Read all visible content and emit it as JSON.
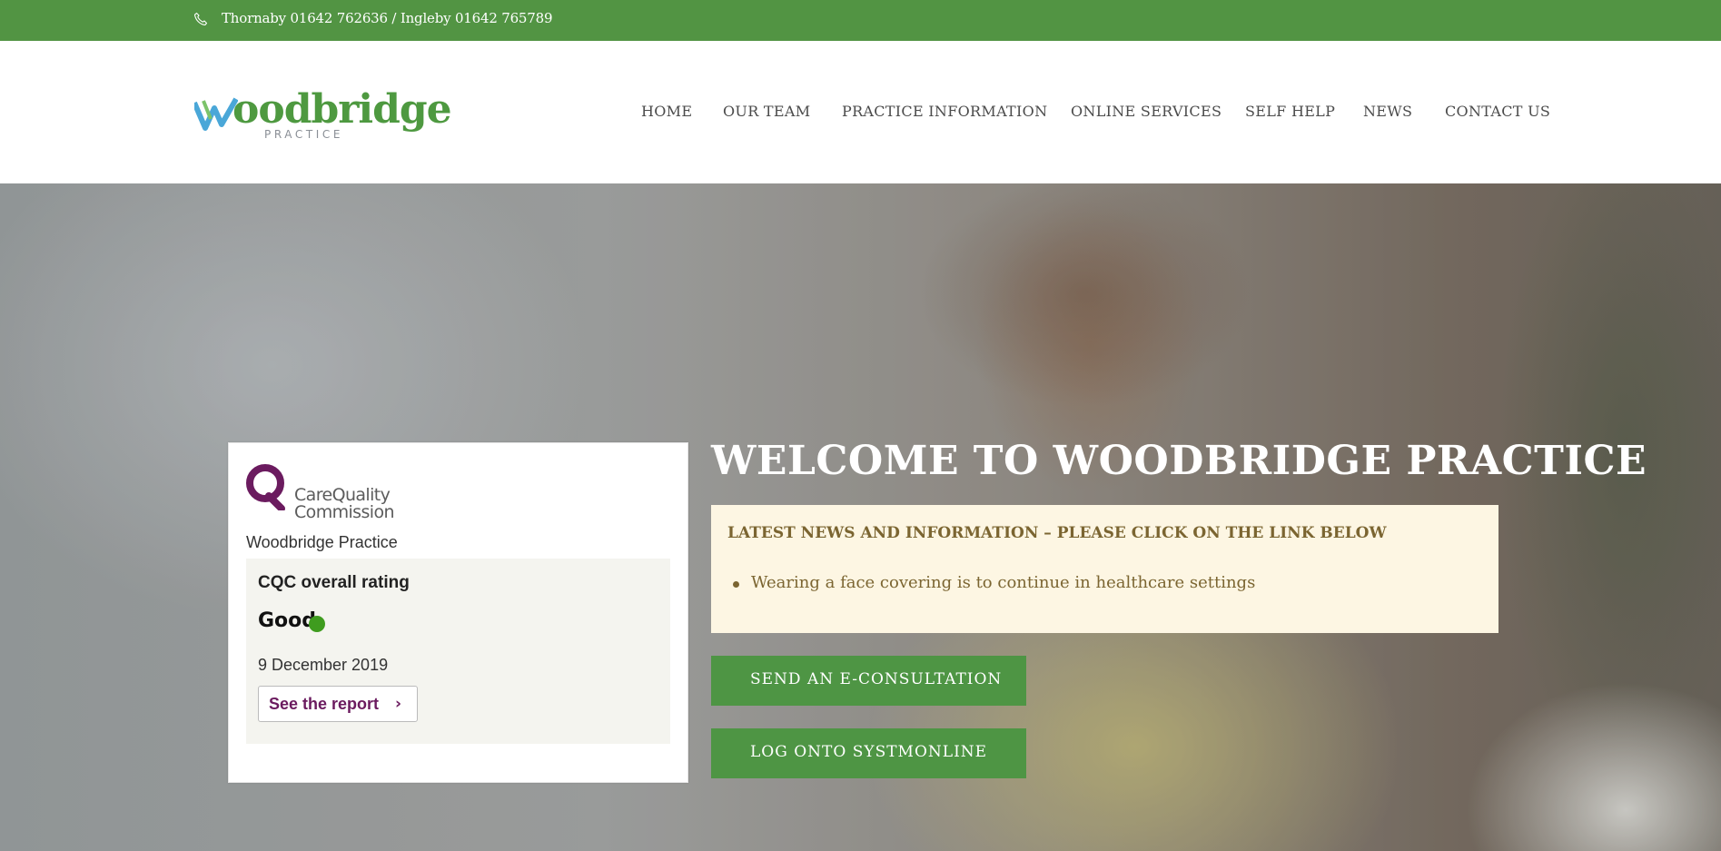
{
  "topbar": {
    "phone_icon": "phone-icon",
    "phone_text": "Thornaby 01642 762636 / Ingleby 01642 765789"
  },
  "header": {
    "logo": {
      "word": "oodbridge",
      "initial": "W",
      "sub": "PRACTICE"
    },
    "nav": [
      {
        "label": "HOME"
      },
      {
        "label": "OUR TEAM"
      },
      {
        "label": "PRACTICE INFORMATION"
      },
      {
        "label": "ONLINE SERVICES"
      },
      {
        "label": "SELF HELP"
      },
      {
        "label": "NEWS"
      },
      {
        "label": "CONTACT US"
      }
    ]
  },
  "cqc": {
    "logo_line1": "CareQuality",
    "logo_line2": "Commission",
    "practice": "Woodbridge Practice",
    "overall_label": "CQC overall rating",
    "rating": "Good",
    "date": "9 December 2019",
    "report_label": "See the report",
    "report_chevron": "›",
    "colors": {
      "brand": "#6b1b5f",
      "good": "#3f9c1f"
    }
  },
  "hero": {
    "welcome": "WELCOME TO WOODBRIDGE PRACTICE",
    "news_heading": "LATEST NEWS AND INFORMATION – PLEASE CLICK ON THE LINK BELOW",
    "news_items": [
      "Wearing a face covering is to continue in healthcare settings"
    ],
    "buttons": [
      {
        "label": "SEND AN E-CONSULTATION"
      },
      {
        "label": "LOG ONTO SYSTMONLINE"
      }
    ]
  },
  "colors": {
    "accent": "#529443",
    "news_bg": "#fdf6e3",
    "news_text": "#7b6531"
  }
}
